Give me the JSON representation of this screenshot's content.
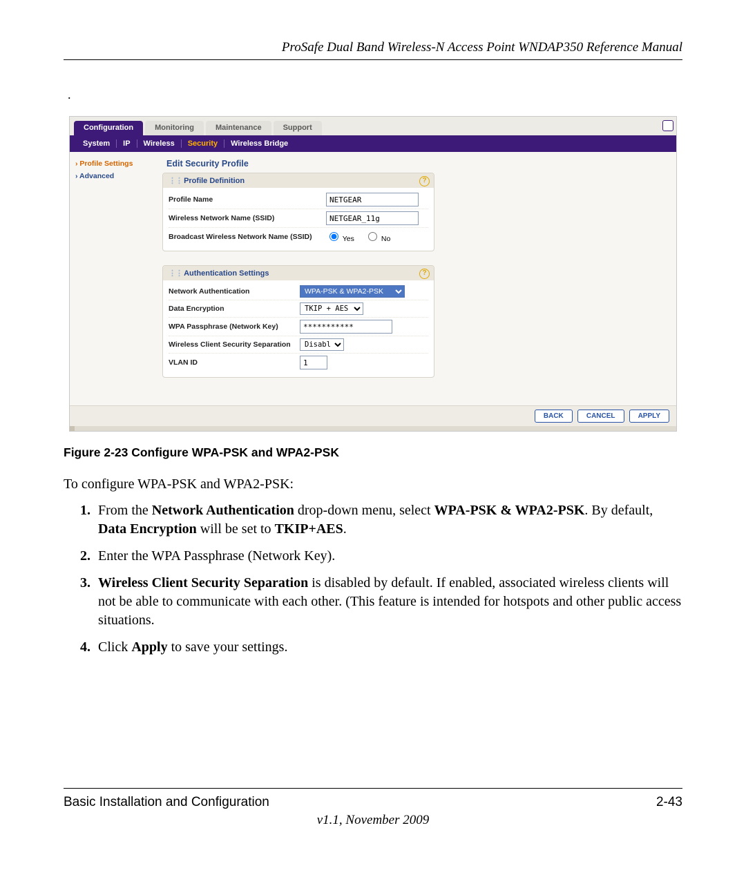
{
  "header": {
    "title": "ProSafe Dual Band Wireless-N Access Point WNDAP350 Reference Manual"
  },
  "router": {
    "tabs": [
      "Configuration",
      "Monitoring",
      "Maintenance",
      "Support"
    ],
    "active_tab_index": 0,
    "subnav": [
      "System",
      "IP",
      "Wireless",
      "Security",
      "Wireless Bridge"
    ],
    "subnav_active_index": 3,
    "side": {
      "items": [
        "Profile Settings",
        "Advanced"
      ],
      "active_index": 0
    },
    "section_title": "Edit Security Profile",
    "panels": {
      "profile": {
        "title": "Profile Definition",
        "rows": {
          "profile_name_label": "Profile Name",
          "profile_name_value": "NETGEAR",
          "ssid_label": "Wireless Network Name (SSID)",
          "ssid_value": "NETGEAR_11g",
          "broadcast_label": "Broadcast Wireless Network Name (SSID)",
          "broadcast_yes": "Yes",
          "broadcast_no": "No"
        }
      },
      "auth": {
        "title": "Authentication Settings",
        "rows": {
          "netauth_label": "Network Authentication",
          "netauth_value": "WPA-PSK & WPA2-PSK",
          "enc_label": "Data Encryption",
          "enc_value": "TKIP + AES",
          "pass_label": "WPA Passphrase (Network Key)",
          "pass_value": "***********",
          "sep_label": "Wireless Client Security Separation",
          "sep_value": "Disable",
          "vlan_label": "VLAN ID",
          "vlan_value": "1"
        }
      }
    },
    "buttons": {
      "back": "BACK",
      "cancel": "CANCEL",
      "apply": "APPLY"
    }
  },
  "caption": "Figure 2-23  Configure WPA-PSK and WPA2-PSK",
  "intro": "To configure WPA-PSK and WPA2-PSK:",
  "steps": {
    "s1_a": "From the ",
    "s1_b": "Network Authentication",
    "s1_c": " drop-down menu, select ",
    "s1_d": "WPA-PSK & WPA2-PSK",
    "s1_e": ". By default, ",
    "s1_f": "Data Encryption",
    "s1_g": " will be set to ",
    "s1_h": "TKIP+AES",
    "s1_i": ".",
    "s2": "Enter the WPA Passphrase (Network Key).",
    "s3_a": "Wireless Client Security Separation",
    "s3_b": " is disabled by default. If enabled, associated wireless clients will not be able to communicate with each other. (This feature is intended for hotspots and other public access situations.",
    "s4_a": "Click ",
    "s4_b": "Apply",
    "s4_c": " to save your settings."
  },
  "footer": {
    "left": "Basic Installation and Configuration",
    "right": "2-43",
    "version": "v1.1, November 2009"
  }
}
